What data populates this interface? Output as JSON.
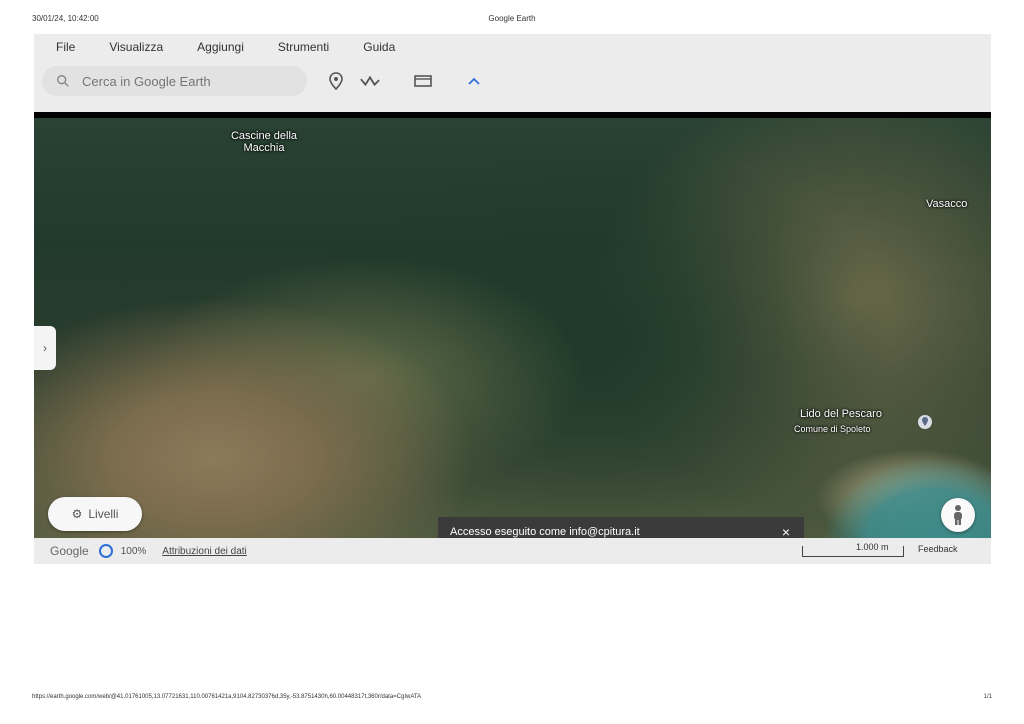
{
  "print": {
    "timestamp": "30/01/24, 10:42:00",
    "title": "Google Earth",
    "url": "https://earth.google.com/web/@41.01761005,13.07721631,110.00761421a,9104.82730376d,35y,-53.8751430h,60.00448317t,360r/data=CgIwATA",
    "page": "1/1"
  },
  "menu": [
    "File",
    "Visualizza",
    "Aggiungi",
    "Strumenti",
    "Guida"
  ],
  "search": {
    "placeholder": "Cerca in Google Earth"
  },
  "toolbar": {
    "icons": [
      "search-icon",
      "placemark-icon",
      "path-icon",
      "card-icon",
      "collapse-icon"
    ]
  },
  "map": {
    "labels": {
      "cascine": "Cascine della\nMacchia",
      "lido": "Lido del Pescaro",
      "lido_sub": "Comune di Spoleto",
      "right_edge": "Vasacco"
    },
    "layers_button": "Livelli"
  },
  "toast": {
    "message": "Accesso eseguito come info@cpitura.it",
    "close": "×"
  },
  "status": {
    "logo": "Google",
    "percent": "100%",
    "credits": "Attribuzioni dei dati",
    "scale": "1.000 m",
    "feedback": "Feedback"
  },
  "colors": {
    "accent": "#2e6fd8",
    "toast_bg": "#3b3b3b"
  }
}
